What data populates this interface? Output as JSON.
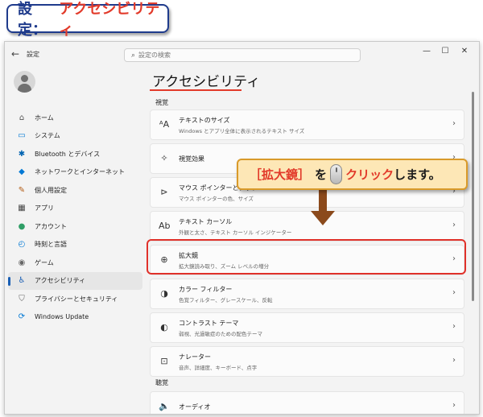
{
  "banner": {
    "prefix": "設定：",
    "title": "アクセシビリティ"
  },
  "window": {
    "app_title": "設定",
    "back_icon": "back-arrow-icon",
    "search_placeholder": "設定の検索",
    "controls": [
      "—",
      "☐",
      "✕"
    ]
  },
  "sidebar": {
    "items": [
      {
        "label": "ホーム",
        "icon": "⌂",
        "color": "#555555"
      },
      {
        "label": "システム",
        "icon": "▭",
        "color": "#0078d4"
      },
      {
        "label": "Bluetooth とデバイス",
        "icon": "✱",
        "color": "#0063b1"
      },
      {
        "label": "ネットワークとインターネット",
        "icon": "◆",
        "color": "#0078d4"
      },
      {
        "label": "個人用設定",
        "icon": "✎",
        "color": "#b25b13"
      },
      {
        "label": "アプリ",
        "icon": "▦",
        "color": "#444444"
      },
      {
        "label": "アカウント",
        "icon": "●",
        "color": "#2f9e66"
      },
      {
        "label": "時刻と言語",
        "icon": "◴",
        "color": "#0078d4"
      },
      {
        "label": "ゲーム",
        "icon": "◉",
        "color": "#666666"
      },
      {
        "label": "アクセシビリティ",
        "icon": "♿",
        "color": "#1a5fb4"
      },
      {
        "label": "プライバシーとセキュリティ",
        "icon": "⛉",
        "color": "#666666"
      },
      {
        "label": "Windows Update",
        "icon": "⟳",
        "color": "#0078d4"
      }
    ],
    "active_index": 9
  },
  "main": {
    "title": "アクセシビリティ",
    "section_vision": "視覚",
    "section_hearing": "聴覚",
    "cards": [
      {
        "icon": "ᴬA",
        "title": "テキストのサイズ",
        "subtitle": "Windows とアプリ全体に表示されるテキスト サイズ"
      },
      {
        "icon": "✧",
        "title": "視覚効果",
        "subtitle": ""
      },
      {
        "icon": "⊳",
        "title": "マウス ポインターとタッチ",
        "subtitle": "マウス ポインターの色、サイズ"
      },
      {
        "icon": "Ab",
        "title": "テキスト カーソル",
        "subtitle": "外観と太さ、テキスト カーソル インジケーター"
      },
      {
        "icon": "⊕",
        "title": "拡大鏡",
        "subtitle": "拡大鏡読み取り、ズーム レベルの増分"
      },
      {
        "icon": "◑",
        "title": "カラー フィルター",
        "subtitle": "色覚フィルター、グレースケール、反転"
      },
      {
        "icon": "◐",
        "title": "コントラスト テーマ",
        "subtitle": "弱視、光過敏症のための配色テーマ"
      },
      {
        "icon": "⊡",
        "title": "ナレーター",
        "subtitle": "音声、詳細度、キーボード、点字"
      },
      {
        "icon": "🔈",
        "title": "オーディオ",
        "subtitle": ""
      }
    ],
    "chevron": "›"
  },
  "callout": {
    "open": "［",
    "item": "拡大鏡",
    "close": "］",
    "particle": "を",
    "action": "クリック",
    "suffix": "します。"
  },
  "colors": {
    "accent_red": "#e23a2a",
    "banner_blue": "#1f3b8c",
    "callout_bg": "#fde7b6",
    "arrow": "#8b4a1c"
  }
}
